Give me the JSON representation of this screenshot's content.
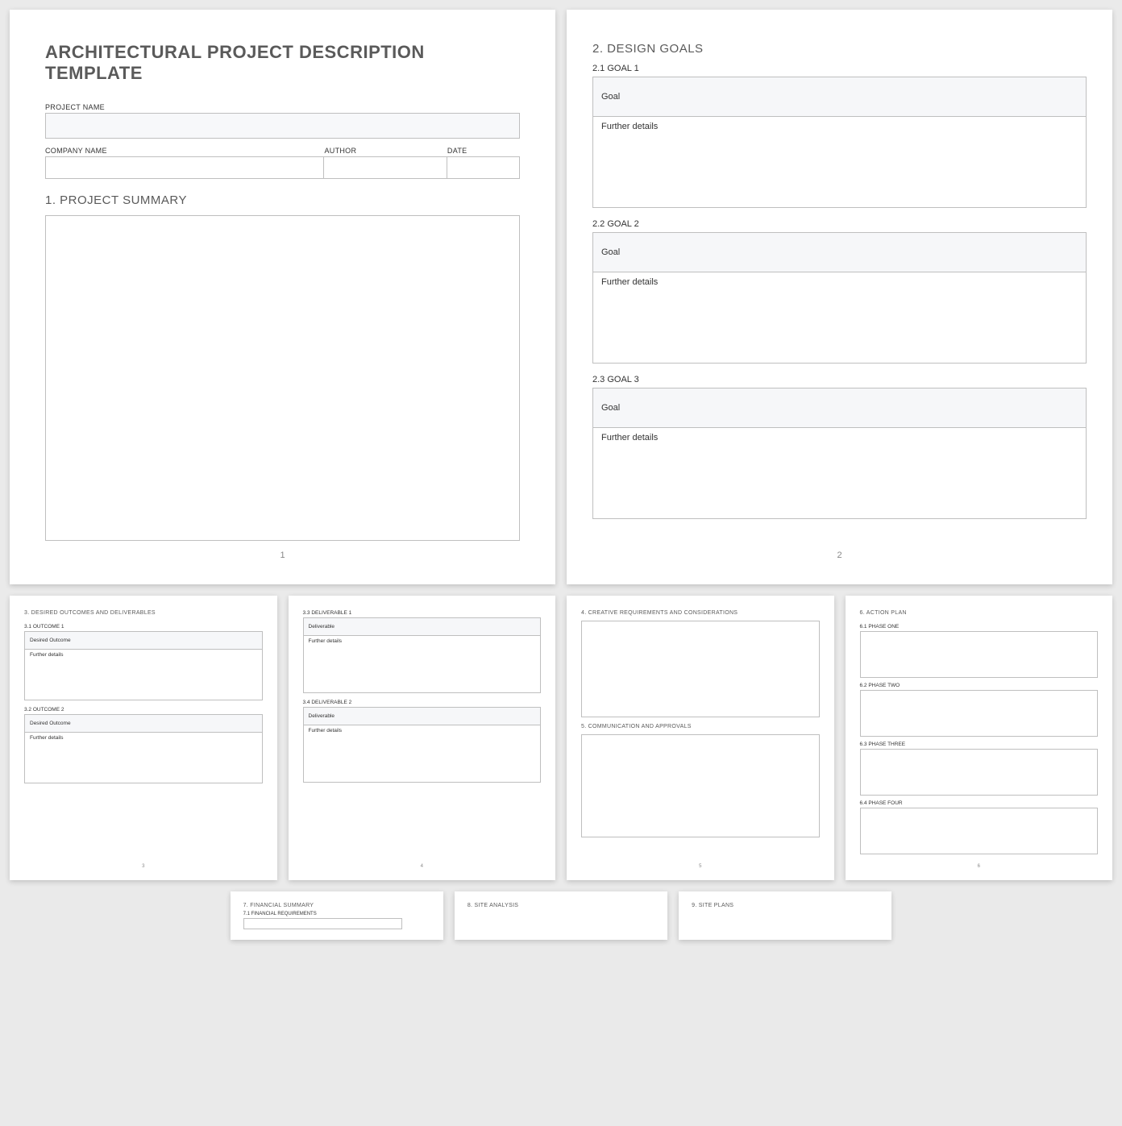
{
  "page1": {
    "title": "ARCHITECTURAL PROJECT DESCRIPTION TEMPLATE",
    "project_name_label": "PROJECT NAME",
    "company_name_label": "COMPANY NAME",
    "author_label": "AUTHOR",
    "date_label": "DATE",
    "section1": "1.  PROJECT SUMMARY",
    "pagenum": "1"
  },
  "page2": {
    "section": "2.  DESIGN GOALS",
    "goals": [
      {
        "sub": "2.1 GOAL 1",
        "goal_label": "Goal",
        "details_label": "Further details"
      },
      {
        "sub": "2.2 GOAL 2",
        "goal_label": "Goal",
        "details_label": "Further details"
      },
      {
        "sub": "2.3 GOAL 3",
        "goal_label": "Goal",
        "details_label": "Further details"
      }
    ],
    "pagenum": "2"
  },
  "page3": {
    "section": "3.  DESIRED OUTCOMES AND DELIVERABLES",
    "o1_sub": "3.1 OUTCOME 1",
    "o1_label": "Desired Outcome",
    "o1_details": "Further details",
    "o2_sub": "3.2 OUTCOME 2",
    "o2_label": "Desired Outcome",
    "o2_details": "Further details",
    "pagenum": "3"
  },
  "page4": {
    "d1_sub": "3.3 DELIVERABLE 1",
    "d1_label": "Deliverable",
    "d1_details": "Further details",
    "d2_sub": "3.4 DELIVERABLE 2",
    "d2_label": "Deliverable",
    "d2_details": "Further details",
    "pagenum": "4"
  },
  "page5": {
    "section4": "4.  CREATIVE REQUIREMENTS AND CONSIDERATIONS",
    "section5": "5.  COMMUNICATION AND APPROVALS",
    "pagenum": "5"
  },
  "page6": {
    "section": "6.  ACTION PLAN",
    "p1": "6.1 PHASE ONE",
    "p2": "6.2 PHASE TWO",
    "p3": "6.3 PHASE THREE",
    "p4": "6.4 PHASE FOUR",
    "pagenum": "6"
  },
  "page7": {
    "section": "7.  FINANCIAL SUMMARY",
    "sub": "7.1 FINANCIAL REQUIREMENTS"
  },
  "page8": {
    "section": "8.  SITE ANALYSIS"
  },
  "page9": {
    "section": "9.  SITE PLANS"
  }
}
